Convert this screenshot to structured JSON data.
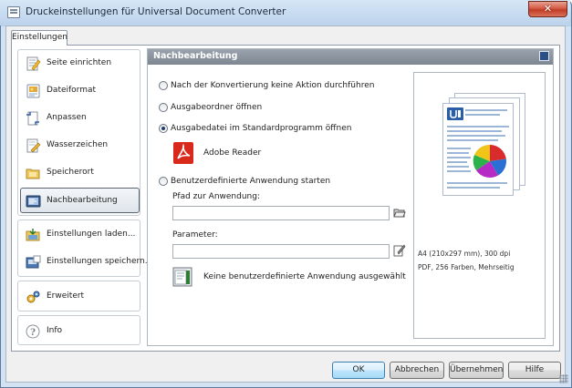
{
  "window": {
    "title": "Druckeinstellungen für Universal Document Converter",
    "close_glyph": "✕"
  },
  "tabs": [
    {
      "label": "Einstellungen"
    }
  ],
  "sidebar": {
    "items": [
      {
        "label": "Seite einrichten",
        "icon": "page-setup-icon"
      },
      {
        "label": "Dateiformat",
        "icon": "file-format-icon"
      },
      {
        "label": "Anpassen",
        "icon": "adjust-icon"
      },
      {
        "label": "Wasserzeichen",
        "icon": "watermark-icon"
      },
      {
        "label": "Speicherort",
        "icon": "save-location-icon"
      },
      {
        "label": "Nachbearbeitung",
        "icon": "post-processing-icon",
        "selected": true
      },
      {
        "label": "Einstellungen laden...",
        "icon": "load-settings-icon"
      },
      {
        "label": "Einstellungen speichern...",
        "icon": "save-settings-icon"
      },
      {
        "label": "Erweitert",
        "icon": "advanced-icon"
      },
      {
        "label": "Info",
        "icon": "info-icon"
      }
    ]
  },
  "panel": {
    "title": "Nachbearbeitung",
    "options": [
      {
        "label": "Nach der Konvertierung keine Aktion durchführen",
        "checked": false
      },
      {
        "label": "Ausgabeordner öffnen",
        "checked": false
      },
      {
        "label": "Ausgabedatei im Standardprogramm öffnen",
        "checked": true
      },
      {
        "label": "Benutzerdefinierte Anwendung starten",
        "checked": false
      }
    ],
    "default_program": "Adobe Reader",
    "app_path_label": "Pfad zur Anwendung:",
    "app_path_value": "",
    "params_label": "Parameter:",
    "params_value": "",
    "no_app_text": "Keine benutzerdefinierte Anwendung ausgewählt"
  },
  "preview": {
    "info_line1": "A4 (210x297 mm), 300 dpi",
    "info_line2": "PDF, 256 Farben, Mehrseitig"
  },
  "buttons": {
    "ok": "OK",
    "cancel": "Abbrechen",
    "apply": "Übernehmen",
    "help": "Hilfe"
  },
  "colors": {
    "selected_border": "#5a6372",
    "panel_header": "#8a939d",
    "default_button": "#bee6fd",
    "pdf_red": "#d9291c"
  }
}
